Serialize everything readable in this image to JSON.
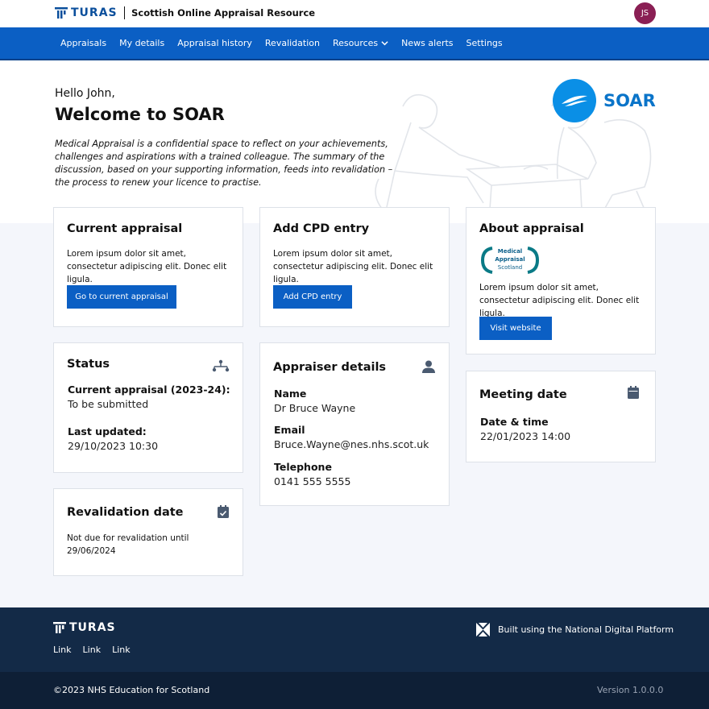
{
  "header": {
    "brand_logo_text": "TURAS",
    "app_title": "Scottish Online Appraisal Resource",
    "user_initials": "JS"
  },
  "nav": {
    "items": [
      {
        "label": "Appraisals"
      },
      {
        "label": "My details"
      },
      {
        "label": "Appraisal history"
      },
      {
        "label": "Revalidation"
      },
      {
        "label": "Resources"
      },
      {
        "label": "News alerts"
      },
      {
        "label": "Settings"
      }
    ]
  },
  "hero": {
    "greeting": "Hello John,",
    "heading": "Welcome to SOAR",
    "intro": "Medical Appraisal is a confidential space to reflect on your achievements, challenges and aspirations with a trained colleague.  The summary of the discussion, based on your supporting information, feeds into revalidation – the process to renew your licence to practise.",
    "logo_text": "SOAR"
  },
  "cards": {
    "current_appraisal": {
      "title": "Current appraisal",
      "body": "Lorem ipsum dolor sit amet, consectetur adipiscing elit. Donec elit ligula.",
      "button": "Go to current appraisal"
    },
    "add_cpd": {
      "title": "Add CPD entry",
      "body": "Lorem ipsum dolor sit amet, consectetur adipiscing elit. Donec elit ligula.",
      "button": "Add CPD entry"
    },
    "about": {
      "title": "About appraisal",
      "logo_lines": [
        "Medical",
        "Appraisal",
        "Scotland"
      ],
      "body": "Lorem ipsum dolor sit amet, consectetur adipiscing elit. Donec elit ligula.",
      "button": "Visit website"
    },
    "status": {
      "title": "Status",
      "label1": "Current appraisal (2023-24):",
      "value1": "To be submitted",
      "label2": "Last updated:",
      "value2": "29/10/2023 10:30"
    },
    "appraiser": {
      "title": "Appraiser details",
      "name_label": "Name",
      "name_value": "Dr Bruce Wayne",
      "email_label": "Email",
      "email_value": "Bruce.Wayne@nes.nhs.scot.uk",
      "phone_label": "Telephone",
      "phone_value": "0141 555 5555"
    },
    "meeting": {
      "title": "Meeting date",
      "label": "Date & time",
      "value": "22/01/2023 14:00"
    },
    "revalidation": {
      "title": "Revalidation date",
      "body": "Not due for revalidation until 29/06/2024"
    }
  },
  "footer": {
    "logo_text": "TURAS",
    "links": [
      "Link",
      "Link",
      "Link"
    ],
    "platform_text": "Built using the National Digital Platform",
    "copyright": "©2023 NHS Education for Scotland",
    "version": "Version 1.0.0.0"
  },
  "colors": {
    "primary": "#0b5fc4",
    "nav_border": "#08418a",
    "avatar": "#8a1f54",
    "footer": "#132a47",
    "footer_bottom": "#0e1f36",
    "page_bg": "#f4f6fb",
    "soar_blue": "#0a8fe6",
    "icon_grey": "#4a5a70"
  },
  "icons": {
    "nav_chevron": "chevron-down-icon",
    "status": "workflow-icon",
    "appraiser": "person-icon",
    "meeting": "calendar-icon",
    "revalidation": "calendar-check-icon",
    "platform": "ndp-icon"
  }
}
